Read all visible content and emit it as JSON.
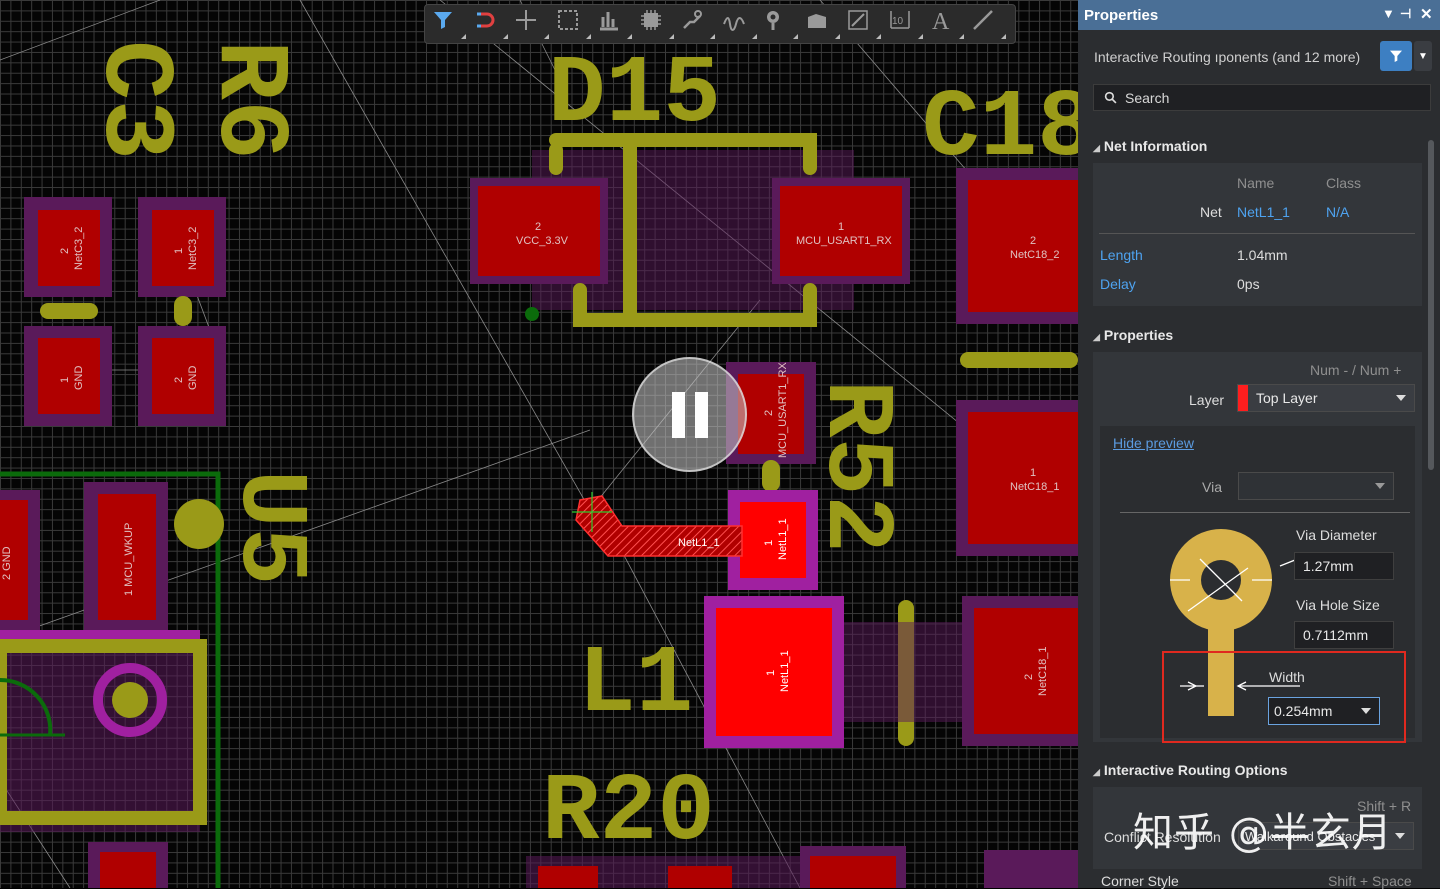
{
  "canvas": {
    "designators": {
      "c3": "C3",
      "r6": "R6",
      "d15": "D15",
      "c18": "C18",
      "r52": "R52",
      "u5": "U5",
      "l1": "L1",
      "r20": "R20"
    },
    "pad_labels": {
      "vcc": "VCC_3.3V",
      "vcc_num": "2",
      "usart_rx": "MCU_USART1_RX",
      "usart_rx_num": "1",
      "usart_rx2": "MCU_USART1_RX",
      "usart_rx2_num": "2",
      "netc3_2": "NetC3_2",
      "netc3_2_num": "2",
      "netc3_2b": "NetC3_2",
      "netc3_2b_num": "1",
      "gnd1": "GND",
      "gnd1_num": "1",
      "gnd2": "GND",
      "gnd2_num": "2",
      "netc18_2": "NetC18_2",
      "netc18_2_num": "2",
      "netc18_1": "NetC18_1",
      "netc18_1_num": "1",
      "netc18_1b": "NetC18_1",
      "netc18_1b_num": "2",
      "netl1_1a": "NetL1_1",
      "netl1_1a_num": "1",
      "netl1_1b": "NetL1_1",
      "netl1_1b_num": "1",
      "trace": "NetL1_1",
      "mcu_wkup": "1  MCU_WKUP",
      "gnd_left": "2  GND"
    },
    "colors": {
      "silk": "#9a9a18",
      "pad": "#b00000",
      "pad_active": "#ff0000",
      "pad_ring": "#6a1a6a",
      "board_outline": "#0b6b0b"
    }
  },
  "toolbar": {
    "icons": [
      "filter-icon",
      "route-magnet-icon",
      "crosshair-icon",
      "select-rect-icon",
      "align-icon",
      "component-icon",
      "interactive-route-icon",
      "diff-pair-icon",
      "via-pin-icon",
      "polygon-fill-icon",
      "line-icon",
      "dimension-icon",
      "text-icon",
      "straight-line-icon"
    ]
  },
  "panel": {
    "title": "Properties",
    "filter_text": "Interactive Routing  ıponents (and 12 more)",
    "search_placeholder": "Search",
    "net_info": {
      "section": "Net Information",
      "col_name": "Name",
      "col_class": "Class",
      "net_label": "Net",
      "net_name": "NetL1_1",
      "net_class": "N/A",
      "length_label": "Length",
      "length_value": "1.04mm",
      "delay_label": "Delay",
      "delay_value": "0ps"
    },
    "properties": {
      "section": "Properties",
      "shortcut": "Num - / Num +",
      "layer_label": "Layer",
      "layer_value": "Top Layer",
      "layer_color": "#ff1e1e",
      "hide_preview": "Hide preview",
      "via_label": "Via",
      "via_value": "",
      "via_diameter_label": "Via Diameter",
      "via_diameter_value": "1.27mm",
      "via_hole_label": "Via Hole Size",
      "via_hole_value": "0.7112mm",
      "width_label": "Width",
      "width_value": "0.254mm"
    },
    "routing": {
      "section": "Interactive Routing Options",
      "shortcut": "Shift + R",
      "conflict_label": "Conflict Resolution",
      "conflict_value": "Walkaround Obstacles",
      "corner_label": "Corner Style",
      "corner_shortcut": "Shift + Space"
    },
    "watermark": "知乎 @半玄月"
  }
}
